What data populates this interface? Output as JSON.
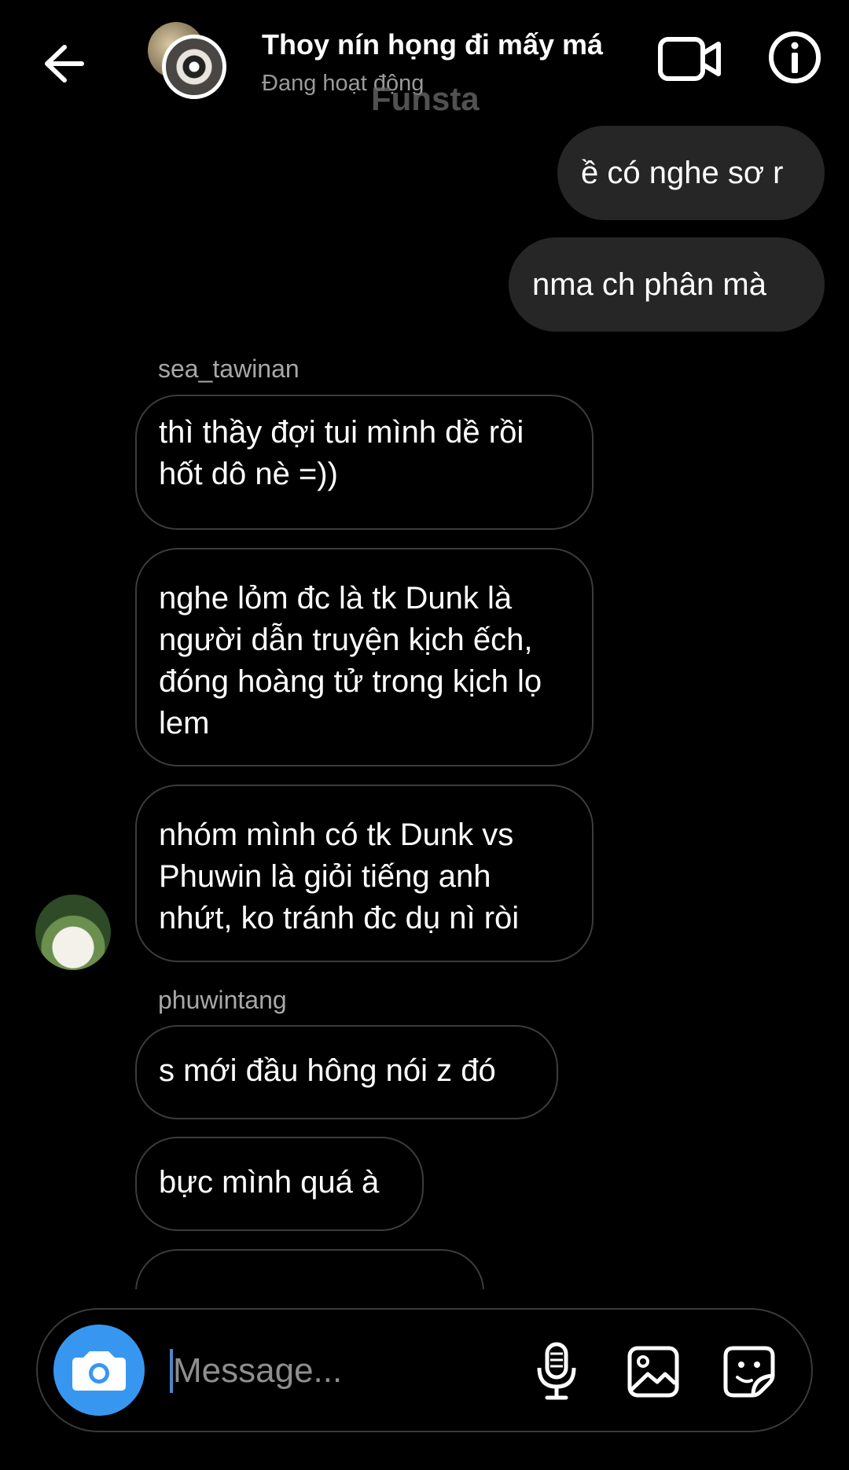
{
  "header": {
    "title": "Thoy nín họng đi mấy má",
    "status": "Đang hoạt động",
    "watermark": "Funsta"
  },
  "messages": [
    {
      "from": "me",
      "text": "ề có nghe sơ r"
    },
    {
      "from": "me",
      "text": "nma ch phân mà"
    },
    {
      "sender": "sea_tawinan",
      "text": "thì thầy đợi tui mình dề rồi hốt dô nè =))"
    },
    {
      "sender": "sea_tawinan",
      "text": "nghe lỏm đc là tk Dunk là người dẫn truyện kịch ếch, đóng hoàng tử trong kịch lọ lem"
    },
    {
      "sender": "sea_tawinan",
      "text": "nhóm mình có tk Dunk vs Phuwin là giỏi tiếng anh nhứt, ko tránh đc dụ nì ròi"
    },
    {
      "sender": "phuwintang",
      "text": "s mới đầu hông nói z đó"
    },
    {
      "sender": "phuwintang",
      "text": "bực mình quá à"
    }
  ],
  "composer": {
    "placeholder": "Message..."
  },
  "icons": {
    "back": "arrow-left-icon",
    "video": "video-call-icon",
    "info": "info-icon",
    "camera": "camera-icon",
    "mic": "microphone-icon",
    "gallery": "gallery-icon",
    "sticker": "sticker-icon"
  },
  "colors": {
    "background": "#000000",
    "my_bubble": "#262626",
    "accent": "#3797f0"
  }
}
